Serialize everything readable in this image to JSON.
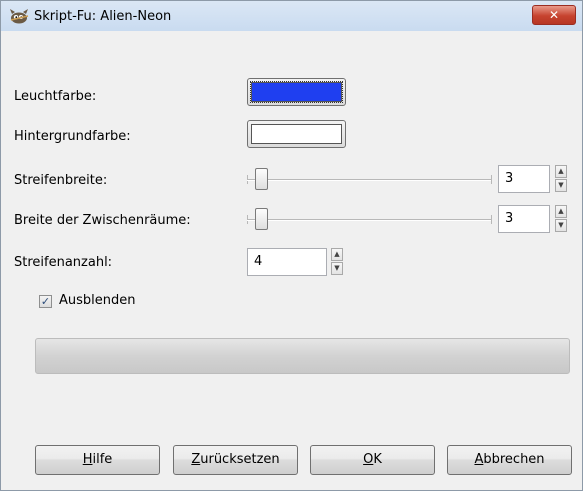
{
  "window": {
    "title": "Skript-Fu: Alien-Neon",
    "close_label": "✕"
  },
  "fields": {
    "glow_color": {
      "label": "Leuchtfarbe:",
      "color": "#1f3ff0"
    },
    "background_color": {
      "label": "Hintergrundfarbe:",
      "color": "#ffffff"
    },
    "stripe_width": {
      "label": "Streifenbreite:",
      "value": "3"
    },
    "gap_width": {
      "label": "Breite der Zwischenräume:",
      "value": "3"
    },
    "stripe_count": {
      "label": "Streifenanzahl:",
      "value": "4"
    },
    "fade": {
      "label": "Ausblenden",
      "checked": true,
      "check_glyph": "✓"
    }
  },
  "progress": {
    "value": 0
  },
  "buttons": {
    "help": {
      "mnemonic": "H",
      "rest": "ilfe"
    },
    "reset": {
      "mnemonic": "Z",
      "rest": "urücksetzen"
    },
    "ok": {
      "mnemonic": "O",
      "rest": "K"
    },
    "cancel": {
      "mnemonic": "A",
      "rest": "bbrechen"
    }
  },
  "icons": {
    "spin_up": "▲",
    "spin_down": "▼",
    "app": "gimp-wilber-icon"
  }
}
